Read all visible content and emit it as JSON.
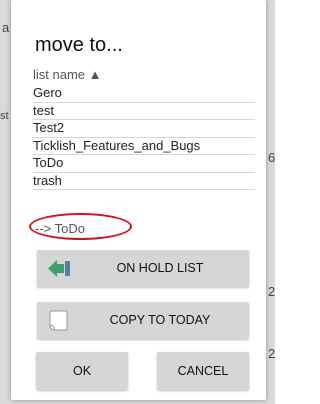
{
  "dialog": {
    "title": "move to...",
    "list_header": "list name ▲",
    "lists": [
      "Gero",
      "test",
      "Test2",
      "Ticklish_Features_and_Bugs",
      "ToDo",
      "trash"
    ],
    "selection": "--> ToDo",
    "buttons": {
      "on_hold": "ON HOLD LIST",
      "copy_today": "COPY TO TODAY",
      "ok": "OK",
      "cancel": "CANCEL"
    }
  },
  "background_peek": {
    "left_1": "a",
    "left_2": "st",
    "right_1": "6",
    "right_2": "2",
    "right_3": "2"
  },
  "colors": {
    "highlight_oval": "#d4121e",
    "arrow_icon": "#3f9f6a",
    "button_bg": "#d6d6d6"
  },
  "icons": {
    "on_hold": "green-arrow-left-icon",
    "copy_today": "page-icon"
  }
}
